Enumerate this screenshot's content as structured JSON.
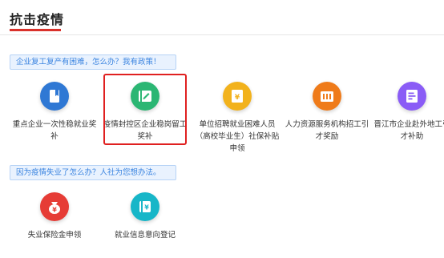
{
  "page": {
    "title": "抗击疫情",
    "accent_color": "#d9312b"
  },
  "sections": [
    {
      "banner": "企业复工复产有困难，怎么办？我有政策！",
      "items": [
        {
          "label": "重点企业一次性稳就业奖补",
          "icon": "bookmark-icon",
          "color": "#2f78d4"
        },
        {
          "label": "疫情封控区企业稳岗留工奖补",
          "icon": "ticket-icon",
          "color": "#2bb673"
        },
        {
          "label": "单位招聘就业困难人员（高校毕业生）社保补贴申领",
          "icon": "document-icon",
          "color": "#f2b21c"
        },
        {
          "label": "人力资源服务机构招工引才奖励",
          "icon": "briefcase-icon",
          "color": "#ef7b1a"
        },
        {
          "label": "晋江市企业赴外地工引才补助",
          "icon": "form-icon",
          "color": "#8a5cf6"
        }
      ]
    },
    {
      "banner": "因为疫情失业了怎么办？人社为您想办法。",
      "items": [
        {
          "label": "失业保险金申领",
          "icon": "money-bag-icon",
          "color": "#e63c36"
        },
        {
          "label": "就业信息意向登记",
          "icon": "registration-icon",
          "color": "#17b6c8"
        }
      ]
    }
  ]
}
